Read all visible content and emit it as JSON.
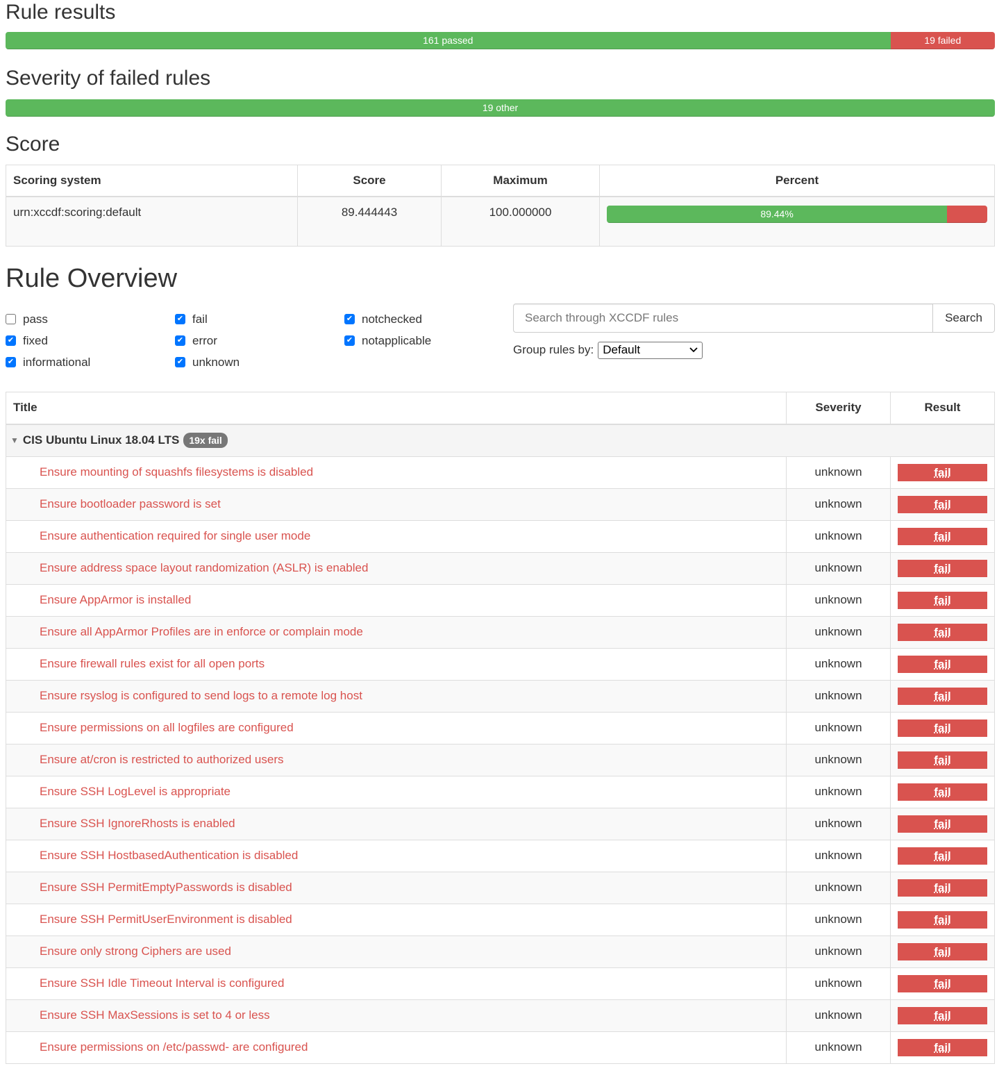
{
  "rule_results": {
    "heading": "Rule results",
    "passed_label": "161 passed",
    "failed_label": "19 failed",
    "passed_count": 161,
    "failed_count": 19,
    "colors": {
      "passed": "#5cb85c",
      "failed": "#d9534f"
    }
  },
  "severity": {
    "heading": "Severity of failed rules",
    "other_label": "19 other",
    "other_count": 19
  },
  "score": {
    "heading": "Score",
    "columns": [
      "Scoring system",
      "Score",
      "Maximum",
      "Percent"
    ],
    "row": {
      "system": "urn:xccdf:scoring:default",
      "score": "89.444443",
      "maximum": "100.000000",
      "percent_label": "89.44%",
      "percent": 89.44
    }
  },
  "overview": {
    "heading": "Rule Overview",
    "filters": [
      {
        "label": "pass",
        "checked": false
      },
      {
        "label": "fail",
        "checked": true
      },
      {
        "label": "notchecked",
        "checked": true
      },
      {
        "label": "fixed",
        "checked": true
      },
      {
        "label": "error",
        "checked": true
      },
      {
        "label": "notapplicable",
        "checked": true
      },
      {
        "label": "informational",
        "checked": true
      },
      {
        "label": "unknown",
        "checked": true
      }
    ],
    "search_placeholder": "Search through XCCDF rules",
    "search_button": "Search",
    "group_by_label": "Group rules by:",
    "group_by_value": "Default"
  },
  "rules_table": {
    "columns": {
      "title": "Title",
      "severity": "Severity",
      "result": "Result"
    },
    "group": {
      "name": "CIS Ubuntu Linux 18.04 LTS",
      "badge": "19x fail"
    },
    "rules": [
      {
        "title": "Ensure mounting of squashfs filesystems is disabled",
        "severity": "unknown",
        "result": "fail"
      },
      {
        "title": "Ensure bootloader password is set",
        "severity": "unknown",
        "result": "fail"
      },
      {
        "title": "Ensure authentication required for single user mode",
        "severity": "unknown",
        "result": "fail"
      },
      {
        "title": "Ensure address space layout randomization (ASLR) is enabled",
        "severity": "unknown",
        "result": "fail"
      },
      {
        "title": "Ensure AppArmor is installed",
        "severity": "unknown",
        "result": "fail"
      },
      {
        "title": "Ensure all AppArmor Profiles are in enforce or complain mode",
        "severity": "unknown",
        "result": "fail"
      },
      {
        "title": "Ensure firewall rules exist for all open ports",
        "severity": "unknown",
        "result": "fail"
      },
      {
        "title": "Ensure rsyslog is configured to send logs to a remote log host",
        "severity": "unknown",
        "result": "fail"
      },
      {
        "title": "Ensure permissions on all logfiles are configured",
        "severity": "unknown",
        "result": "fail"
      },
      {
        "title": "Ensure at/cron is restricted to authorized users",
        "severity": "unknown",
        "result": "fail"
      },
      {
        "title": "Ensure SSH LogLevel is appropriate",
        "severity": "unknown",
        "result": "fail"
      },
      {
        "title": "Ensure SSH IgnoreRhosts is enabled",
        "severity": "unknown",
        "result": "fail"
      },
      {
        "title": "Ensure SSH HostbasedAuthentication is disabled",
        "severity": "unknown",
        "result": "fail"
      },
      {
        "title": "Ensure SSH PermitEmptyPasswords is disabled",
        "severity": "unknown",
        "result": "fail"
      },
      {
        "title": "Ensure SSH PermitUserEnvironment is disabled",
        "severity": "unknown",
        "result": "fail"
      },
      {
        "title": "Ensure only strong Ciphers are used",
        "severity": "unknown",
        "result": "fail"
      },
      {
        "title": "Ensure SSH Idle Timeout Interval is configured",
        "severity": "unknown",
        "result": "fail"
      },
      {
        "title": "Ensure SSH MaxSessions is set to 4 or less",
        "severity": "unknown",
        "result": "fail"
      },
      {
        "title": "Ensure permissions on /etc/passwd- are configured",
        "severity": "unknown",
        "result": "fail"
      }
    ]
  }
}
